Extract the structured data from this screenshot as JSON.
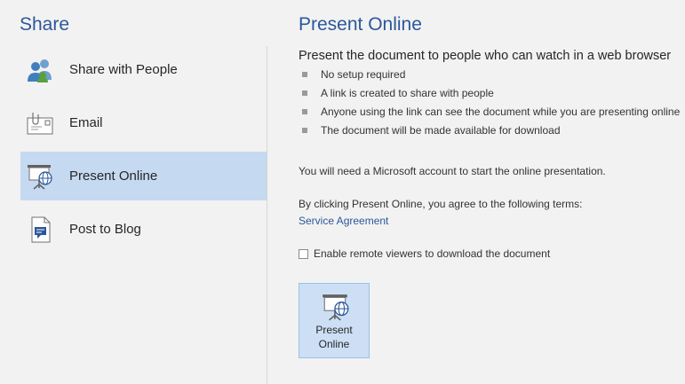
{
  "left": {
    "title": "Share",
    "items": [
      {
        "label": "Share with People",
        "icon": "people-icon",
        "selected": false
      },
      {
        "label": "Email",
        "icon": "email-icon",
        "selected": false
      },
      {
        "label": "Present Online",
        "icon": "present-online-icon",
        "selected": true
      },
      {
        "label": "Post to Blog",
        "icon": "blog-icon",
        "selected": false
      }
    ]
  },
  "right": {
    "title": "Present Online",
    "intro": "Present the document to people who can watch in a web browser",
    "bullets": [
      "No setup required",
      "A link is created to share with people",
      "Anyone using the link can see the document while you are presenting online",
      "The document will be made available for download"
    ],
    "account_note": "You will need a Microsoft account to start the online presentation.",
    "terms_note": "By clicking Present Online, you agree to the following terms:",
    "service_link": "Service Agreement",
    "checkbox_label": "Enable remote viewers to download the document",
    "checkbox_checked": false,
    "button_label_line1": "Present",
    "button_label_line2": "Online"
  },
  "colors": {
    "accent": "#2b579a",
    "selected_bg": "#c5d9f1",
    "background": "#f2f2f2"
  }
}
